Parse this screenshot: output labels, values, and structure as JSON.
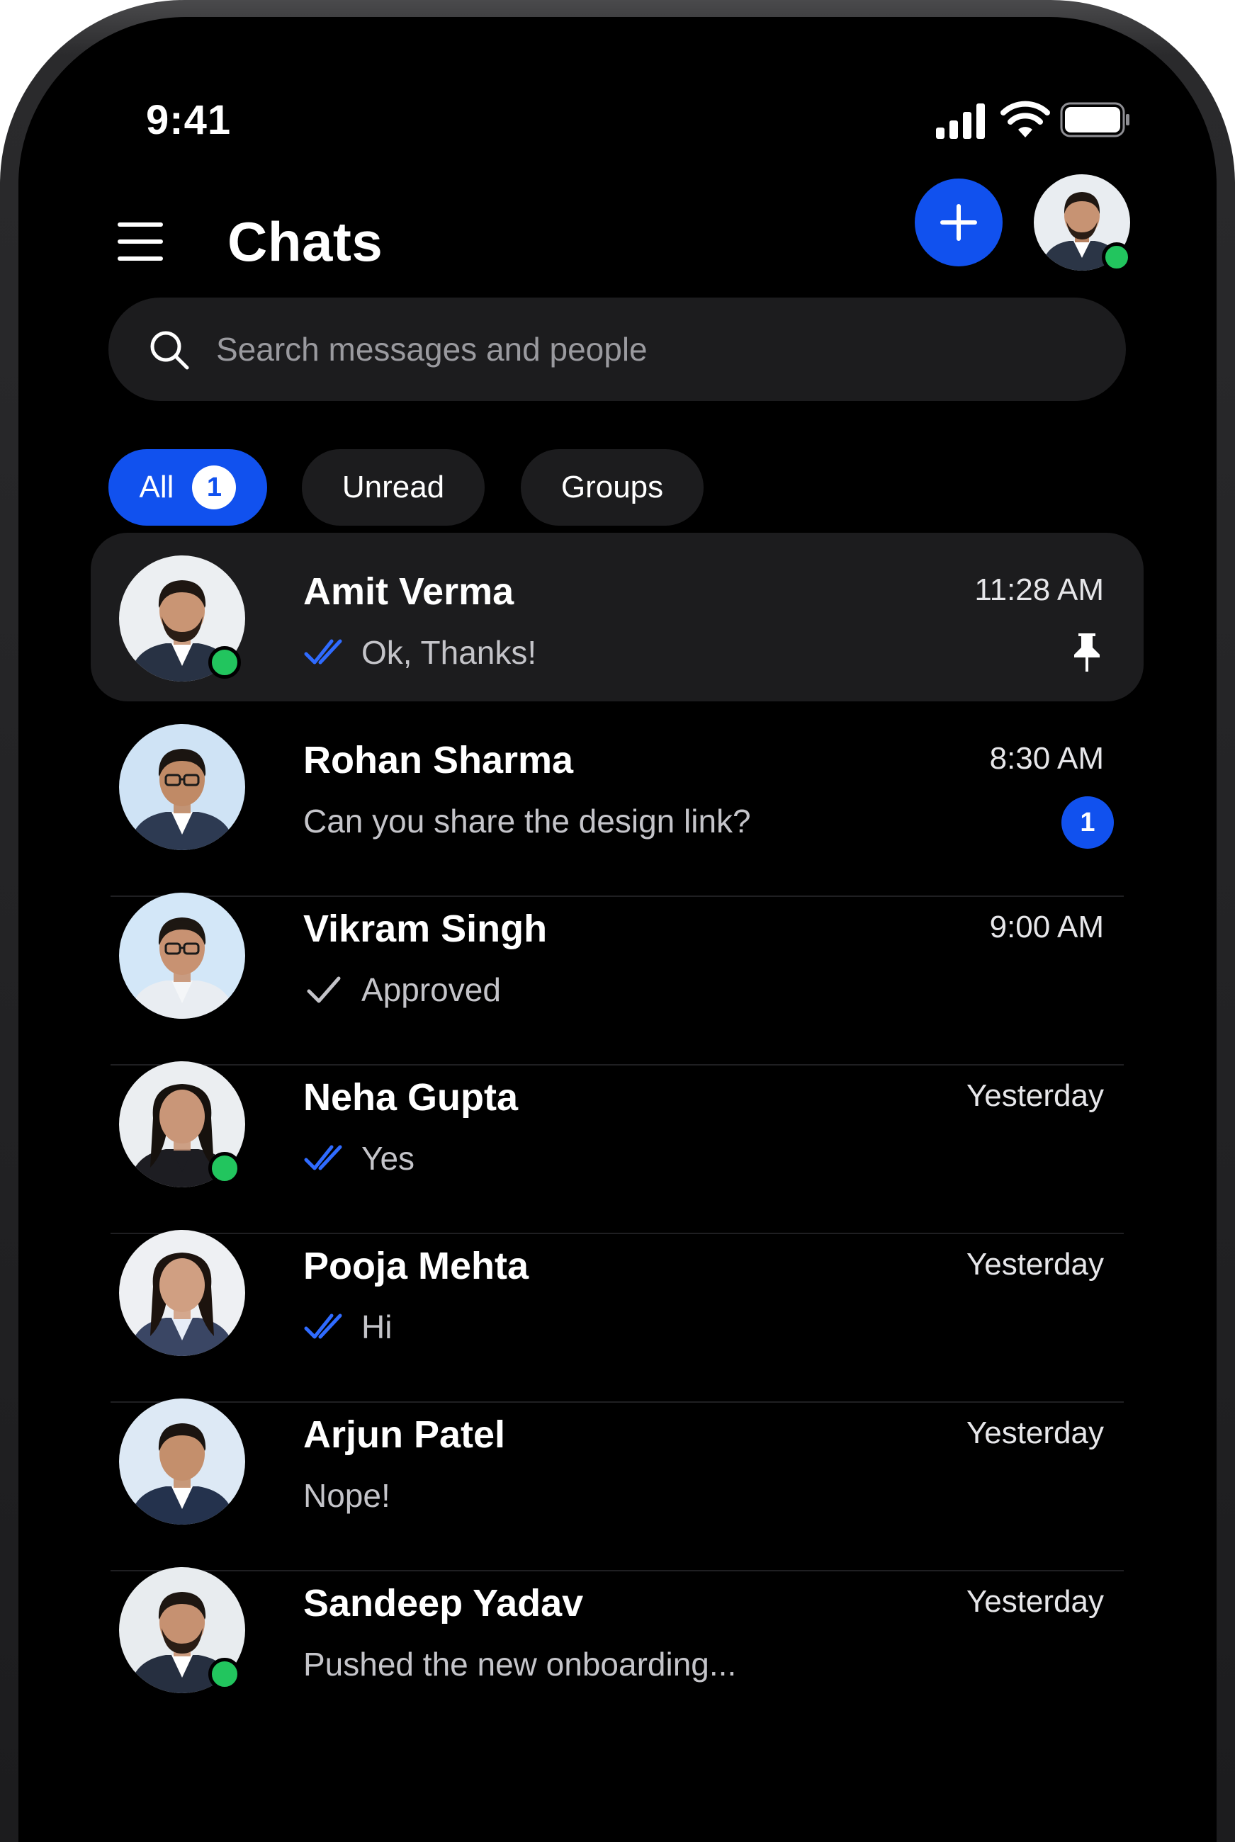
{
  "status_bar": {
    "time": "9:41"
  },
  "header": {
    "title": "Chats"
  },
  "search": {
    "placeholder": "Search messages and people"
  },
  "filters": [
    {
      "label": "All",
      "badge": "1",
      "active": true
    },
    {
      "label": "Unread",
      "active": false
    },
    {
      "label": "Groups",
      "active": false
    }
  ],
  "chats": [
    {
      "name": "Amit Verma",
      "time": "11:28 AM",
      "preview": "Ok, Thanks!",
      "status": "read",
      "online": true,
      "pinned": true
    },
    {
      "name": "Rohan Sharma",
      "time": "8:30 AM",
      "preview": "Can you share the design link?",
      "status": "none",
      "online": false,
      "unread": "1"
    },
    {
      "name": "Vikram Singh",
      "time": "9:00 AM",
      "preview": "Approved",
      "status": "sent",
      "online": false
    },
    {
      "name": "Neha Gupta",
      "time": "Yesterday",
      "preview": "Yes",
      "status": "read",
      "online": true
    },
    {
      "name": "Pooja Mehta",
      "time": "Yesterday",
      "preview": "Hi",
      "status": "read",
      "online": false
    },
    {
      "name": "Arjun Patel",
      "time": "Yesterday",
      "preview": "Nope!",
      "status": "none",
      "online": false
    },
    {
      "name": "Sandeep Yadav",
      "time": "Yesterday",
      "preview": "Pushed the new onboarding...",
      "status": "none",
      "online": true
    }
  ],
  "colors": {
    "accent": "#1151ee",
    "online": "#22c55e",
    "background": "#000000",
    "surface": "#1c1c1e",
    "read_tick": "#2f6bff"
  },
  "icons": {
    "menu": "menu-icon",
    "new_chat": "plus-icon",
    "search": "search-icon",
    "read": "double-check-icon",
    "sent": "check-icon",
    "pin": "pin-icon"
  }
}
